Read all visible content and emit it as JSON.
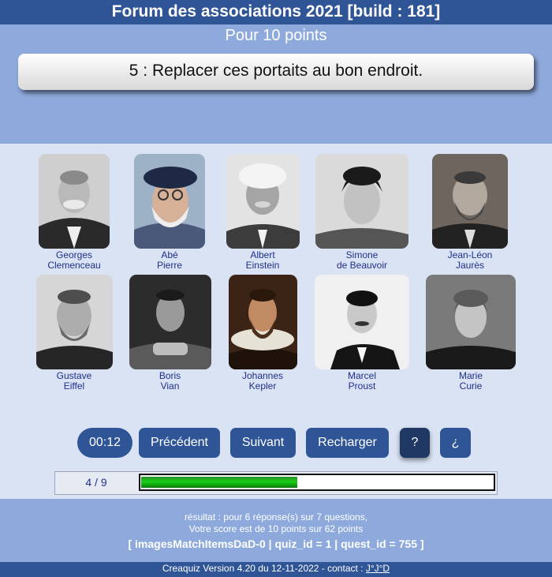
{
  "header": {
    "title": "Forum des associations 2021 [build : 181]"
  },
  "question": {
    "points": "Pour 10 points",
    "text": "5 : Replacer ces portaits au bon endroit."
  },
  "portraits": [
    {
      "line1": "Georges",
      "line2": "Clemenceau",
      "icon": "portrait-clemenceau-icon"
    },
    {
      "line1": "Abé",
      "line2": "Pierre",
      "icon": "portrait-abbe-pierre-icon"
    },
    {
      "line1": "Albert",
      "line2": "Einstein",
      "icon": "portrait-einstein-icon"
    },
    {
      "line1": "Simone",
      "line2": "de Beauvoir",
      "icon": "portrait-beauvoir-icon"
    },
    {
      "line1": "Jean-Léon",
      "line2": "Jaurès",
      "icon": "portrait-jaures-icon"
    },
    {
      "line1": "Gustave",
      "line2": "Eiffel",
      "icon": "portrait-eiffel-icon"
    },
    {
      "line1": "Boris",
      "line2": "Vian",
      "icon": "portrait-vian-icon"
    },
    {
      "line1": "Johannes",
      "line2": "Kepler",
      "icon": "portrait-kepler-icon"
    },
    {
      "line1": "Marcel",
      "line2": "Proust",
      "icon": "portrait-proust-icon"
    },
    {
      "line1": "Marie",
      "line2": "Curie",
      "icon": "portrait-curie-icon"
    }
  ],
  "controls": {
    "timer": "00:12",
    "previous": "Précédent",
    "next": "Suivant",
    "reload": "Recharger",
    "help": "?",
    "inverse_help": "¿"
  },
  "progress": {
    "label": "4 / 9",
    "fraction": 0.444
  },
  "result": {
    "line1": "résultat : pour 6 réponse(s) sur 7 questions,",
    "line2": "Votre score est de 10 points sur 62 points",
    "debug": "[ imagesMatchItemsDaD-0 | quiz_id = 1 | quest_id = 755 ]"
  },
  "footer": {
    "text": "Creaquiz Version 4.20 du 12-11-2022 - contact : ",
    "contact": "J°J°D"
  },
  "colors": {
    "primary": "#2f5597",
    "header_zone": "#8eaadc",
    "body": "#d9e3f3",
    "progress": "#18c018"
  }
}
